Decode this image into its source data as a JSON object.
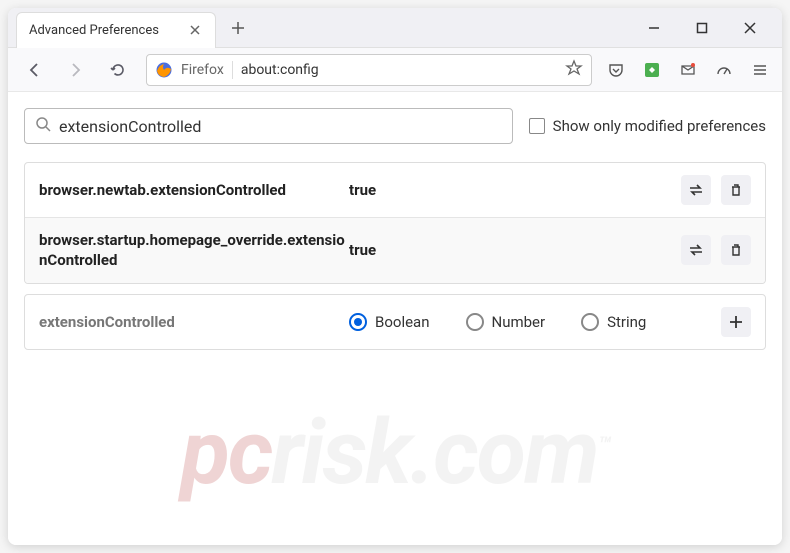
{
  "tab": {
    "title": "Advanced Preferences"
  },
  "urlbar": {
    "label": "Firefox",
    "url": "about:config"
  },
  "search": {
    "value": "extensionControlled"
  },
  "checkbox_label": "Show only modified preferences",
  "prefs": [
    {
      "name": "browser.newtab.extensionControlled",
      "value": "true"
    },
    {
      "name": "browser.startup.homepage_override.extensionControlled",
      "value": "true"
    }
  ],
  "add": {
    "name": "extensionControlled",
    "types": [
      "Boolean",
      "Number",
      "String"
    ],
    "selected": "Boolean"
  },
  "watermark": {
    "pc": "pc",
    "rest": "risk.com",
    "tm": "™"
  }
}
